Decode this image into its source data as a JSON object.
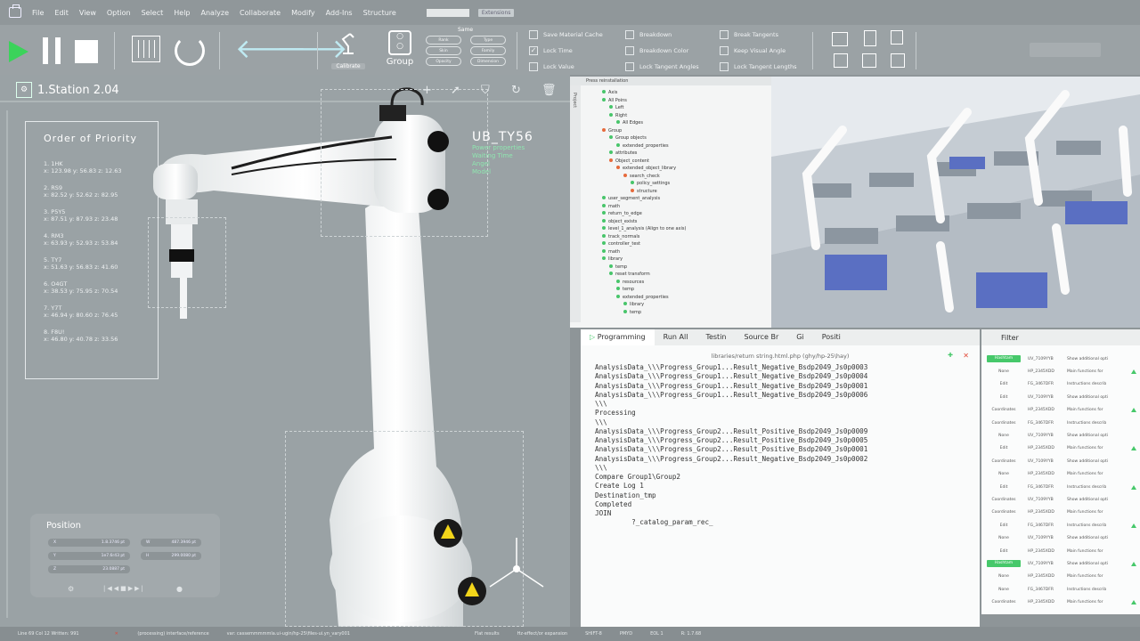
{
  "menu": [
    "File",
    "Edit",
    "View",
    "Option",
    "Select",
    "Help",
    "Analyze",
    "Collaborate",
    "Modify",
    "Add-Ins",
    "Structure"
  ],
  "menu_tag": "Extensions",
  "toolbar": {
    "calibrate_label": "Calibrate",
    "group_label": "Group",
    "same_label": "Same",
    "pills": [
      "Rank",
      "Type",
      "Skin",
      "Family",
      "Opacity",
      "Dimension"
    ],
    "checks": [
      {
        "label": "Save Material Cache",
        "checked": false
      },
      {
        "label": "Lock Time",
        "checked": true
      },
      {
        "label": "Lock Value",
        "checked": false
      },
      {
        "label": "Breakdown",
        "checked": false
      },
      {
        "label": "Breakdown Color",
        "checked": false
      },
      {
        "label": "Lock Tangent Angles",
        "checked": false
      },
      {
        "label": "Break Tangents",
        "checked": false
      },
      {
        "label": "Keep Visual Angle",
        "checked": false
      },
      {
        "label": "Lock Tangent Lengths",
        "checked": false
      }
    ]
  },
  "station": {
    "title": "1.Station 2.04"
  },
  "priority": {
    "title": "Order of Priority",
    "items": [
      {
        "name": "1. 1HK",
        "coords": "x: 123.98 y: 56.83 z: 12.63"
      },
      {
        "name": "2. RS9",
        "coords": "x: 82.52 y: 52.62 z: 82.95"
      },
      {
        "name": "3. P5Y5",
        "coords": "x: 87.51 y: 87.93 z: 23.48"
      },
      {
        "name": "4. RM3",
        "coords": "x: 63.93 y: 52.93 z: 53.84"
      },
      {
        "name": "5. TY7",
        "coords": "x: 51.63 y: 56.83 z: 41.60"
      },
      {
        "name": "6. O4GT",
        "coords": "x: 38.53 y: 75.95 z: 70.54"
      },
      {
        "name": "7. Y7T",
        "coords": "x: 46.94 y: 80.60 z: 76.45"
      },
      {
        "name": "8. F8U!",
        "coords": "x: 46.80 y: 40.78 z: 33.56"
      }
    ]
  },
  "ub": {
    "title": "UB_TY56",
    "lines": [
      "Power properties",
      "Waiting Time",
      "Angel",
      "Model"
    ]
  },
  "position": {
    "title": "Position",
    "fields": [
      {
        "k": "X",
        "v": "1.8.3746 pt"
      },
      {
        "k": "W",
        "v": "487.3946 pt"
      },
      {
        "k": "Y",
        "v": "1e7.6r43 pt"
      },
      {
        "k": "H",
        "v": "299.0080 pt"
      },
      {
        "k": "Z",
        "v": "23.0887 pt"
      }
    ]
  },
  "project": {
    "header": "Press reinstallation",
    "side_tab": "Project",
    "tree": [
      {
        "t": "Axis",
        "l": 1,
        "c": "#47c56a"
      },
      {
        "t": "All Poins",
        "l": 1,
        "c": "#47c56a"
      },
      {
        "t": "Left",
        "l": 2,
        "c": "#47c56a"
      },
      {
        "t": "Right",
        "l": 2,
        "c": "#47c56a"
      },
      {
        "t": "All Edges",
        "l": 3,
        "c": "#47c56a"
      },
      {
        "t": "Group",
        "l": 1,
        "c": "#e66a3c"
      },
      {
        "t": "Group objects",
        "l": 2,
        "c": "#47c56a"
      },
      {
        "t": "extended_properties",
        "l": 3,
        "c": "#47c56a"
      },
      {
        "t": "attributes",
        "l": 2,
        "c": "#47c56a"
      },
      {
        "t": "Object_content",
        "l": 2,
        "c": "#e66a3c"
      },
      {
        "t": "extended_object_library",
        "l": 3,
        "c": "#e66a3c"
      },
      {
        "t": "search_check",
        "l": 4,
        "c": "#e66a3c"
      },
      {
        "t": "policy_settings",
        "l": 5,
        "c": "#47c56a"
      },
      {
        "t": "structure",
        "l": 5,
        "c": "#e66a3c"
      },
      {
        "t": "user_segment_analysis",
        "l": 1,
        "c": "#47c56a"
      },
      {
        "t": "math",
        "l": 1,
        "c": "#47c56a"
      },
      {
        "t": "return_to_edge",
        "l": 1,
        "c": "#47c56a"
      },
      {
        "t": "object_exists",
        "l": 1,
        "c": "#47c56a"
      },
      {
        "t": "level_1_analysis (Align to one axis)",
        "l": 1,
        "c": "#47c56a"
      },
      {
        "t": "track_normals",
        "l": 1,
        "c": "#47c56a"
      },
      {
        "t": "controller_test",
        "l": 1,
        "c": "#47c56a"
      },
      {
        "t": "math",
        "l": 1,
        "c": "#47c56a"
      },
      {
        "t": "library",
        "l": 1,
        "c": "#47c56a"
      },
      {
        "t": "temp",
        "l": 2,
        "c": "#47c56a"
      },
      {
        "t": "reset transform",
        "l": 2,
        "c": "#47c56a"
      },
      {
        "t": "resources",
        "l": 3,
        "c": "#47c56a"
      },
      {
        "t": "temp",
        "l": 3,
        "c": "#47c56a"
      },
      {
        "t": "extended_properties",
        "l": 3,
        "c": "#47c56a"
      },
      {
        "t": "library",
        "l": 4,
        "c": "#47c56a"
      },
      {
        "t": "temp",
        "l": 4,
        "c": "#47c56a"
      }
    ]
  },
  "console": {
    "tabs": [
      "Programming",
      "Run All",
      "Testin",
      "Source Br",
      "Gi",
      "Positi"
    ],
    "path": "libraries/return string.html.php (ghy/hp-25\\hay)",
    "lines": [
      "AnalysisData_\\\\\\Progress_Group1...Result_Negative_Bsdp2049_Js0p0003",
      "AnalysisData_\\\\\\Progress_Group1...Result_Negative_Bsdp2049_Js0p0004",
      "AnalysisData_\\\\\\Progress_Group1...Result_Negative_Bsdp2049_Js0p0001",
      "AnalysisData_\\\\\\Progress_Group1...Result_Negative_Bsdp2049_Js0p0006",
      "\\\\\\",
      "Processing",
      "\\\\\\",
      "AnalysisData_\\\\\\Progress_Group2...Result_Positive_Bsdp2049_Js0p0009",
      "AnalysisData_\\\\\\Progress_Group2...Result_Positive_Bsdp2049_Js0p0005",
      "AnalysisData_\\\\\\Progress_Group2...Result_Positive_Bsdp2049_Js0p0001",
      "AnalysisData_\\\\\\Progress_Group2...Result_Negative_Bsdp2049_Js0p0002",
      "\\\\\\",
      "Compare Group1\\Group2",
      "Create Log 1",
      "Destination_tmp",
      "Completed",
      "JOIN",
      "         ?_catalog_param_rec_"
    ]
  },
  "filter": {
    "title": "Filter",
    "rows": [
      {
        "a": "Hashtam",
        "hl": true,
        "b": "UV_7109YYB",
        "c": "Show additional opti"
      },
      {
        "a": "None",
        "hl": false,
        "b": "HP_2345XDD",
        "c": "Main functions for"
      },
      {
        "a": "Edit",
        "hl": false,
        "b": "FG_3467DFR",
        "c": "Instructions describ"
      },
      {
        "a": "Edit",
        "hl": false,
        "b": "UV_7109YYB",
        "c": "Show additional opti"
      },
      {
        "a": "Coordinates",
        "hl": false,
        "b": "HP_2345XDD",
        "c": "Main functions for"
      },
      {
        "a": "Coordinates",
        "hl": false,
        "b": "FG_3467DFR",
        "c": "Instructions describ"
      },
      {
        "a": "None",
        "hl": false,
        "b": "UV_7109YYB",
        "c": "Show additional opti"
      },
      {
        "a": "Edit",
        "hl": false,
        "b": "HP_2345XDD",
        "c": "Main functions for"
      },
      {
        "a": "Coordinates",
        "hl": false,
        "b": "UV_7109YYB",
        "c": "Show additional opti"
      },
      {
        "a": "None",
        "hl": false,
        "b": "HP_2345XDD",
        "c": "Main functions for"
      },
      {
        "a": "Edit",
        "hl": false,
        "b": "FG_3467DFR",
        "c": "Instructions describ"
      },
      {
        "a": "Coordinates",
        "hl": false,
        "b": "UV_7109YYB",
        "c": "Show additional opti"
      },
      {
        "a": "Coordinates",
        "hl": false,
        "b": "HP_2345XDD",
        "c": "Main functions for"
      },
      {
        "a": "Edit",
        "hl": false,
        "b": "FG_3467DFR",
        "c": "Instructions describ"
      },
      {
        "a": "None",
        "hl": false,
        "b": "UV_7109YYB",
        "c": "Show additional opti"
      },
      {
        "a": "Edit",
        "hl": false,
        "b": "HP_2345XDD",
        "c": "Main functions for"
      },
      {
        "a": "Hashtam",
        "hl": true,
        "b": "UV_7109YYB",
        "c": "Show additional opti"
      },
      {
        "a": "None",
        "hl": false,
        "b": "HP_2345XDD",
        "c": "Main functions for"
      },
      {
        "a": "None",
        "hl": false,
        "b": "FG_3467DFR",
        "c": "Instructions describ"
      },
      {
        "a": "Coordinates",
        "hl": false,
        "b": "HP_2345XDD",
        "c": "Main functions for"
      }
    ]
  },
  "status": {
    "left": "Line 69 Col 12 Written: 991",
    "error": "(processing) interface/reference",
    "path": "var: cassemmmmmla.ui-ugin/hp-25\\files-ui.yn_vary001",
    "right": [
      "Flat results",
      "Hz-effect/or expansion",
      "SHIFT-8",
      "PMYD",
      "EOL 1",
      "R: 1.7.68"
    ]
  },
  "colors": {
    "accent_green": "#3bd35a",
    "ui_gray": "#9aa2a5",
    "panel_white": "#f4f5f5"
  }
}
